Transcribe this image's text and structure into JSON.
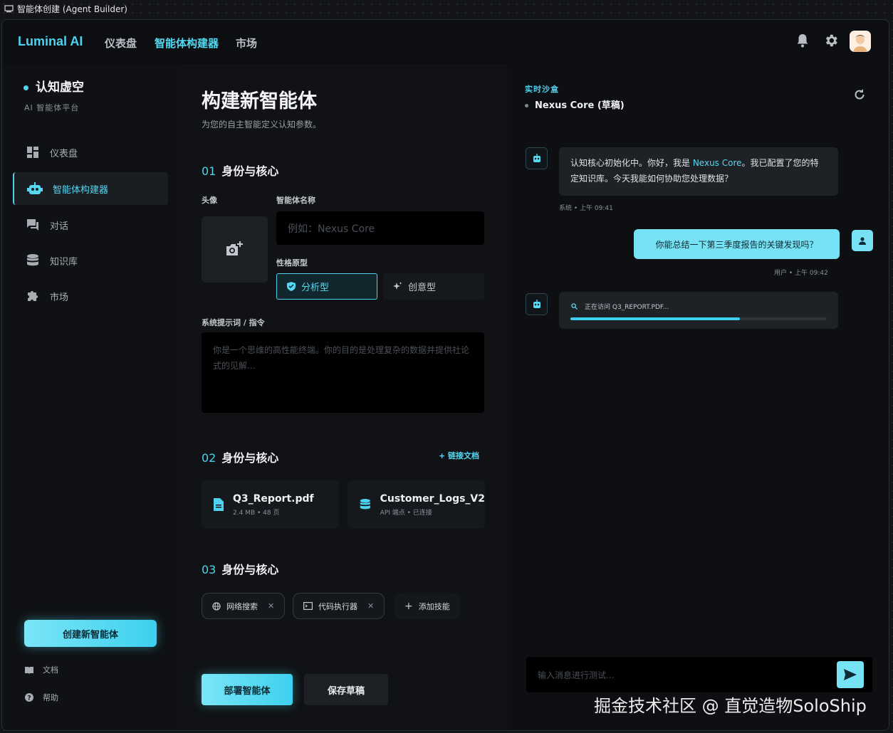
{
  "window": {
    "title": "智能体创建 (Agent Builder)"
  },
  "header": {
    "brand": "Luminal AI",
    "nav": [
      {
        "label": "仪表盘"
      },
      {
        "label": "智能体构建器"
      },
      {
        "label": "市场"
      }
    ],
    "icons": [
      "bell-icon",
      "gear-icon",
      "avatar"
    ]
  },
  "sidebar": {
    "org_name": "认知虚空",
    "org_sub": "AI 智能体平台",
    "items": [
      {
        "label": "仪表盘",
        "icon": "dashboard-icon"
      },
      {
        "label": "智能体构建器",
        "icon": "robot-icon"
      },
      {
        "label": "对话",
        "icon": "chat-icon"
      },
      {
        "label": "知识库",
        "icon": "database-icon"
      },
      {
        "label": "市场",
        "icon": "puzzle-icon"
      }
    ],
    "new_agent": "创建新智能体",
    "docs": "文档",
    "help": "帮助"
  },
  "main": {
    "title": "构建新智能体",
    "subtitle": "为您的自主智能定义认知参数。",
    "s1": {
      "num": "01",
      "title": "身份与核心"
    },
    "avatar_label": "头像",
    "name_label": "智能体名称",
    "name_placeholder": "例如：Nexus Core",
    "archetype_label": "性格原型",
    "archetypes": [
      "分析型",
      "创意型"
    ],
    "prompt_label": "系统提示词 / 指令",
    "prompt_placeholder": "你是一个思维的高性能终端。你的目的是处理复杂的数据并提供社论式的见解...",
    "s2": {
      "num": "02",
      "title": "身份与核心"
    },
    "link_docs": "+ 链接文档",
    "docs": [
      {
        "title": "Q3_Report.pdf",
        "meta": "2.4 MB • 48 页"
      },
      {
        "title": "Customer_Logs_V2",
        "meta": "API 端点 • 已连接"
      }
    ],
    "s3": {
      "num": "03",
      "title": "身份与核心"
    },
    "skills": [
      "网络搜索",
      "代码执行器"
    ],
    "add_skill": "添加技能",
    "deploy": "部署智能体",
    "save": "保存草稿"
  },
  "sandbox": {
    "label": "实时沙盒",
    "agent_name": "Nexus Core (草稿)",
    "msg1_pre": "认知核心初始化中。你好，我是 ",
    "msg1_name": "Nexus Core",
    "msg1_post": "。我已配置了您的特定知识库。今天我能如何协助您处理数据？",
    "msg1_meta": "系统 • 上午 09:41",
    "user_msg": "你能总结一下第三季度报告的关键发现吗？",
    "user_meta": "用户 • 上午 09:42",
    "progress_text": "正在访问 Q3_REPORT.PDF...",
    "progress": 0.66,
    "input_placeholder": "输入消息进行测试..."
  },
  "watermark": "掘金技术社区 @ 直觉造物SoloShip",
  "colors": {
    "accent": "#4fd2ee",
    "user_bubble": "#78e2f5"
  }
}
